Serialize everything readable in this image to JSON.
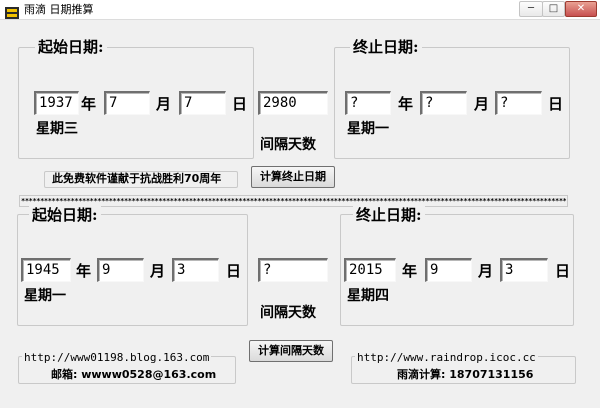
{
  "window": {
    "title": "雨滴 日期推算",
    "minimize": "─",
    "maximize": "□",
    "close": "✕"
  },
  "top": {
    "start_label": "起始日期:",
    "end_label": "终止日期:",
    "start": {
      "year": "1937",
      "month": "7",
      "day": "7",
      "weekday": "星期三"
    },
    "end": {
      "year": "?",
      "month": "?",
      "day": "?",
      "weekday": "星期一"
    },
    "interval_value": "2980",
    "interval_label": "间隔天数",
    "dedication": "此免费软件谨献于抗战胜利70周年",
    "calc_end_button": "计算终止日期"
  },
  "bottom": {
    "start_label": "起始日期:",
    "end_label": "终止日期:",
    "start": {
      "year": "1945",
      "month": "9",
      "day": "3",
      "weekday": "星期一"
    },
    "end": {
      "year": "2015",
      "month": "9",
      "day": "3",
      "weekday": "星期四"
    },
    "interval_value": "?",
    "interval_label": "间隔天数",
    "calc_interval_button": "计算间隔天数"
  },
  "units": {
    "year": "年",
    "month": "月",
    "day": "日"
  },
  "separator": "************************************************************************************************************************************************",
  "footer": {
    "left_url": "http://www01198.blog.163.com",
    "left_email": "邮箱: wwww0528@163.com",
    "right_url": "http://www.raindrop.icoc.cc",
    "right_text": "雨滴计算: 18707131156"
  },
  "colors": {
    "window_bg": "#f0f0f0",
    "field_bg": "#ffffff",
    "close_red": "#c75050"
  }
}
